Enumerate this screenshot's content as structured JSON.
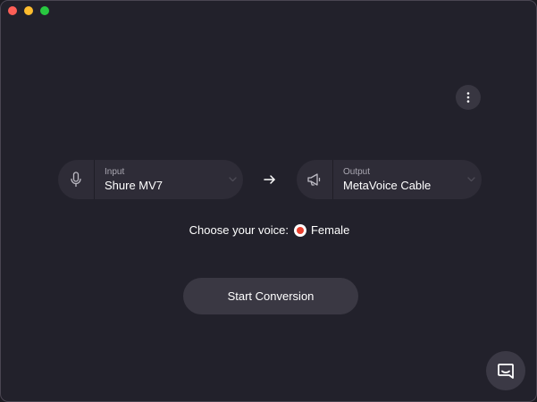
{
  "window": {
    "controls": [
      "close",
      "minimize",
      "zoom"
    ]
  },
  "toolbar": {
    "more_icon": "vertical-dots-icon"
  },
  "input_device": {
    "label": "Input",
    "value": "Shure MV7",
    "icon": "microphone-icon"
  },
  "output_device": {
    "label": "Output",
    "value": "MetaVoice Cable",
    "icon": "megaphone-icon"
  },
  "voice": {
    "prompt": "Choose your voice:",
    "selected": "Female"
  },
  "actions": {
    "start_label": "Start Conversion"
  },
  "chat": {
    "icon": "chat-icon"
  },
  "colors": {
    "background": "#22212b",
    "panel": "#2e2c37",
    "button": "#3a3843",
    "accent": "#e8402f"
  }
}
